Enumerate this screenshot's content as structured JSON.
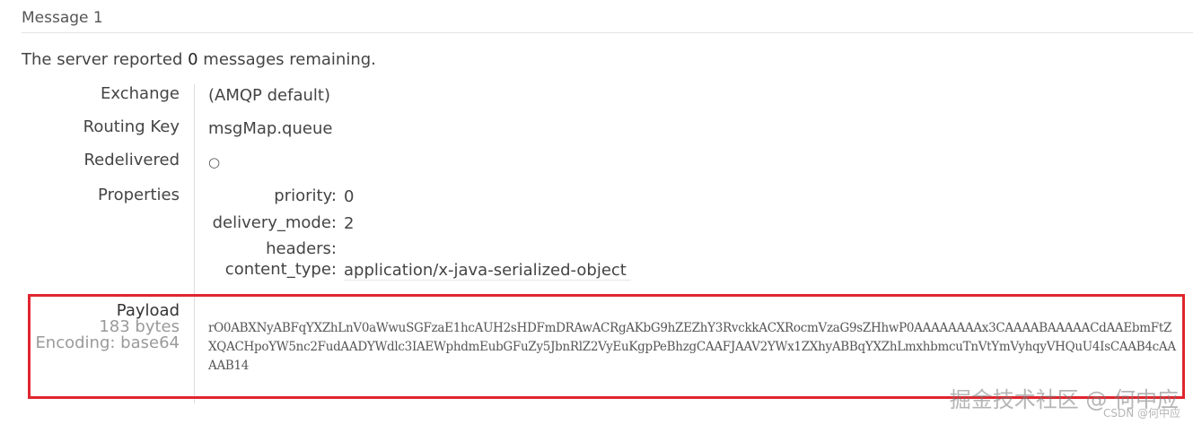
{
  "message": {
    "title": "Message 1",
    "status_prefix": "The server reported ",
    "status_count": "0",
    "status_suffix": " messages remaining."
  },
  "fields": {
    "exchange_label": "Exchange",
    "exchange_value": "(AMQP default)",
    "routing_key_label": "Routing Key",
    "routing_key_value": "msgMap.queue",
    "redelivered_label": "Redelivered",
    "redelivered_value": "○",
    "properties_label": "Properties"
  },
  "properties": {
    "priority_key": "priority:",
    "priority_value": "0",
    "delivery_mode_key": "delivery_mode:",
    "delivery_mode_value": "2",
    "headers_key": "headers:",
    "content_type_key": "content_type:",
    "content_type_value": "application/x-java-serialized-object"
  },
  "payload": {
    "label": "Payload",
    "size": "183 bytes",
    "encoding": "Encoding: base64",
    "data": "rO0ABXNyABFqYXZhLnV0aWwuSGFzaE1hcAUH2sHDFmDRAwACRgAKbG9hZEZhY3RvckkACXRocmVzaG9sZHhwP0AAAAAAAAx3CAAAABAAAAACdAAEbmFtZXQACHpoYW5nc2FudAADYWdlc3IAEWphdmEubGFuZy5JbnRlZ2VyEuKgpPeBhzgCAAFJAAV2YWx1ZXhyABBqYXZhLmxhbmcuTnVtYmVyhqyVHQuU4IsCAAB4cAAAAB14"
  },
  "watermark": {
    "main": "掘金技术社区 @ 何中应",
    "sub": "CSDN @何中应"
  }
}
